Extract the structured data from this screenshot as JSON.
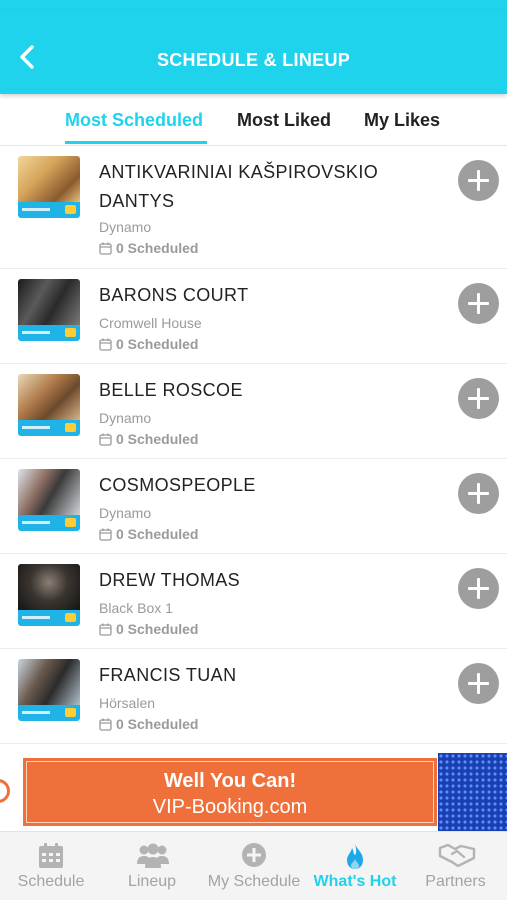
{
  "header": {
    "title": "SCHEDULE & LINEUP"
  },
  "tabs": [
    {
      "label": "Most Scheduled",
      "active": true
    },
    {
      "label": "Most Liked",
      "active": false
    },
    {
      "label": "My Likes",
      "active": false
    }
  ],
  "lineup": [
    {
      "artist": "ANTIKVARINIAI KAŠPIROVSKIO DANTYS",
      "venue": "Dynamo",
      "scheduled": "0 Scheduled"
    },
    {
      "artist": "BARONS COURT",
      "venue": "Cromwell House",
      "scheduled": "0 Scheduled"
    },
    {
      "artist": "BELLE ROSCOE",
      "venue": "Dynamo",
      "scheduled": "0 Scheduled"
    },
    {
      "artist": "COSMOSPEOPLE",
      "venue": "Dynamo",
      "scheduled": "0 Scheduled"
    },
    {
      "artist": "DREW THOMAS",
      "venue": "Black Box 1",
      "scheduled": "0 Scheduled"
    },
    {
      "artist": "FRANCIS TUAN",
      "venue": "Hörsalen",
      "scheduled": "0 Scheduled"
    }
  ],
  "ad": {
    "line1": "Well You Can!",
    "line2": "VIP-Booking.com"
  },
  "bottom_nav": [
    {
      "label": "Schedule",
      "icon": "calendar-icon",
      "active": false
    },
    {
      "label": "Lineup",
      "icon": "people-icon",
      "active": false
    },
    {
      "label": "My Schedule",
      "icon": "plus-circle-icon",
      "active": false
    },
    {
      "label": "What's Hot",
      "icon": "flame-icon",
      "active": true
    },
    {
      "label": "Partners",
      "icon": "handshake-icon",
      "active": false
    }
  ],
  "colors": {
    "accent": "#1fd3ec",
    "add_button": "#9e9e9e",
    "ad_orange": "#f0703c"
  }
}
